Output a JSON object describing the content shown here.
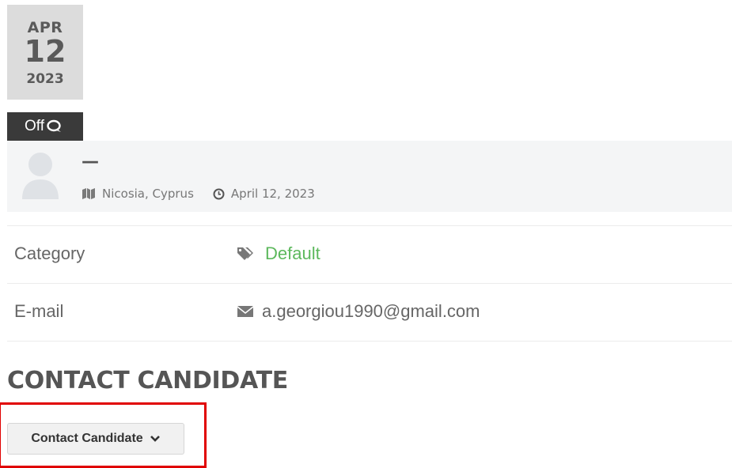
{
  "post_date": {
    "month": "APR",
    "day": "12",
    "year": "2023"
  },
  "comments": {
    "label": "Off",
    "icon": "comments-icon"
  },
  "candidate": {
    "name": "—",
    "avatar_icon": "user-avatar-icon",
    "location": "Nicosia, Cyprus",
    "location_icon": "map-icon",
    "posted_date": "April 12, 2023",
    "date_icon": "clock-icon"
  },
  "details": {
    "category": {
      "label": "Category",
      "value": "Default",
      "icon": "tags-icon",
      "value_color": "#5cb85c"
    },
    "email": {
      "label": "E-mail",
      "value": "a.georgiou1990@gmail.com",
      "icon": "envelope-icon"
    }
  },
  "contact_section": {
    "title": "CONTACT CANDIDATE",
    "button_label": "Contact Candidate",
    "button_icon": "chevron-down-icon",
    "highlight_color": "#e00000"
  }
}
